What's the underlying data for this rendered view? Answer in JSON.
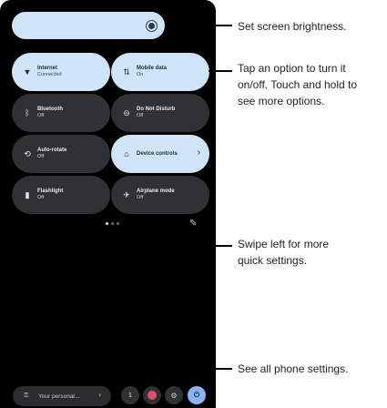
{
  "brightness": {
    "icon": "brightness-icon"
  },
  "tiles": [
    {
      "name": "Internet",
      "state": "Connected",
      "icon": "wifi-icon",
      "on": true
    },
    {
      "name": "Mobile data",
      "state": "On",
      "icon": "mobile-data-icon",
      "on": true
    },
    {
      "name": "Bluetooth",
      "state": "Off",
      "icon": "bluetooth-icon",
      "on": false
    },
    {
      "name": "Do Not Disturb",
      "state": "Off",
      "icon": "dnd-icon",
      "on": false
    },
    {
      "name": "Auto-rotate",
      "state": "Off",
      "icon": "rotate-icon",
      "on": false
    },
    {
      "name": "Device controls",
      "state": "",
      "icon": "home-icon",
      "on": true
    },
    {
      "name": "Flashlight",
      "state": "Off",
      "icon": "flashlight-icon",
      "on": false
    },
    {
      "name": "Airplane mode",
      "state": "Off",
      "icon": "airplane-icon",
      "on": false
    }
  ],
  "footer": {
    "pill_label": "Your personal...",
    "user_badge": "1"
  },
  "callouts": {
    "brightness": "Set screen brightness.",
    "tap_line1": "Tap an option to turn it",
    "tap_line2": "on/off. Touch and hold to",
    "tap_line3": "see more options.",
    "swipe_line1": "Swipe left for more",
    "swipe_line2": "quick settings.",
    "settings": "See all phone settings."
  },
  "colors": {
    "panel": "#000000",
    "tile_on": "#cfe5f7",
    "tile_off": "#2f3134",
    "accent": "#8ab4f8"
  }
}
